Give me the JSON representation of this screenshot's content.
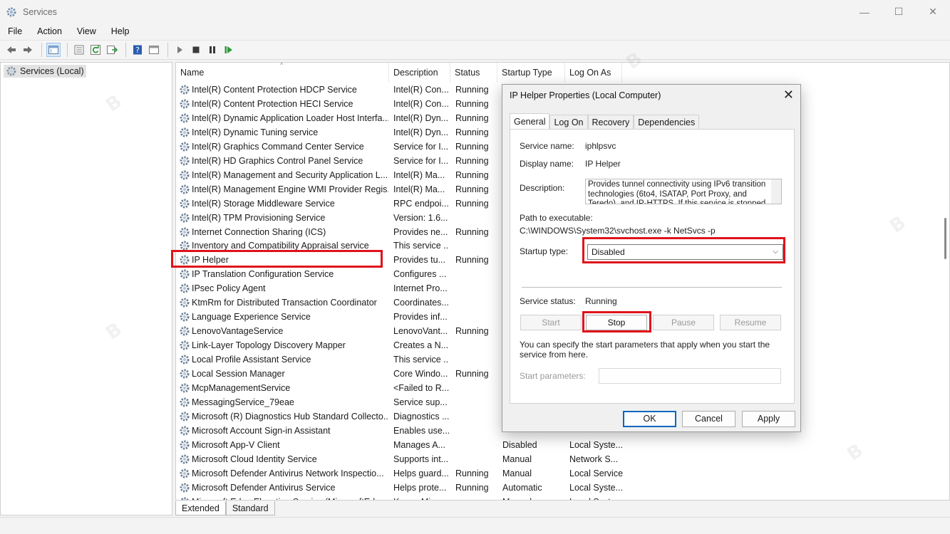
{
  "window": {
    "title": "Services",
    "controls": [
      "—",
      "☐",
      "✕"
    ]
  },
  "menu": [
    "File",
    "Action",
    "View",
    "Help"
  ],
  "toolbar": {
    "icons": [
      "back-icon",
      "forward-icon",
      "show-hide-console-tree-icon",
      "properties-icon",
      "refresh-icon",
      "export-list-icon",
      "help-icon",
      "console-icon",
      "start-service-icon",
      "stop-service-icon",
      "pause-service-icon",
      "restart-service-icon"
    ]
  },
  "tree": {
    "label": "Services (Local)"
  },
  "columns": {
    "name": "Name",
    "description": "Description",
    "status": "Status",
    "startup": "Startup Type",
    "logon": "Log On As"
  },
  "rows": [
    {
      "name": "Intel(R) Content Protection HDCP Service",
      "desc": "Intel(R) Con...",
      "status": "Running",
      "startup": "",
      "logon": ""
    },
    {
      "name": "Intel(R) Content Protection HECI Service",
      "desc": "Intel(R) Con...",
      "status": "Running",
      "startup": "",
      "logon": ""
    },
    {
      "name": "Intel(R) Dynamic Application Loader Host Interfa...",
      "desc": "Intel(R) Dyn...",
      "status": "Running",
      "startup": "",
      "logon": ""
    },
    {
      "name": "Intel(R) Dynamic Tuning service",
      "desc": "Intel(R) Dyn...",
      "status": "Running",
      "startup": "",
      "logon": ""
    },
    {
      "name": "Intel(R) Graphics Command Center Service",
      "desc": "Service for I...",
      "status": "Running",
      "startup": "",
      "logon": ""
    },
    {
      "name": "Intel(R) HD Graphics Control Panel Service",
      "desc": "Service for I...",
      "status": "Running",
      "startup": "",
      "logon": ""
    },
    {
      "name": "Intel(R) Management and Security Application L...",
      "desc": "Intel(R) Ma...",
      "status": "Running",
      "startup": "",
      "logon": ""
    },
    {
      "name": "Intel(R) Management Engine WMI Provider Regis...",
      "desc": "Intel(R) Ma...",
      "status": "Running",
      "startup": "",
      "logon": ""
    },
    {
      "name": "Intel(R) Storage Middleware Service",
      "desc": "RPC endpoi...",
      "status": "Running",
      "startup": "",
      "logon": ""
    },
    {
      "name": "Intel(R) TPM Provisioning Service",
      "desc": "Version: 1.6...",
      "status": "",
      "startup": "",
      "logon": ""
    },
    {
      "name": "Internet Connection Sharing (ICS)",
      "desc": "Provides ne...",
      "status": "Running",
      "startup": "",
      "logon": ""
    },
    {
      "name": "Inventory and Compatibility Appraisal service",
      "desc": "This service ...",
      "status": "",
      "startup": "",
      "logon": ""
    },
    {
      "name": "IP Helper",
      "desc": "Provides tu...",
      "status": "Running",
      "startup": "",
      "logon": ""
    },
    {
      "name": "IP Translation Configuration Service",
      "desc": "Configures ...",
      "status": "",
      "startup": "",
      "logon": ""
    },
    {
      "name": "IPsec Policy Agent",
      "desc": "Internet Pro...",
      "status": "",
      "startup": "",
      "logon": ""
    },
    {
      "name": "KtmRm for Distributed Transaction Coordinator",
      "desc": "Coordinates...",
      "status": "",
      "startup": "",
      "logon": ""
    },
    {
      "name": "Language Experience Service",
      "desc": "Provides inf...",
      "status": "",
      "startup": "",
      "logon": ""
    },
    {
      "name": "LenovoVantageService",
      "desc": "LenovoVant...",
      "status": "Running",
      "startup": "",
      "logon": ""
    },
    {
      "name": "Link-Layer Topology Discovery Mapper",
      "desc": "Creates a N...",
      "status": "",
      "startup": "",
      "logon": ""
    },
    {
      "name": "Local Profile Assistant Service",
      "desc": "This service ...",
      "status": "",
      "startup": "",
      "logon": ""
    },
    {
      "name": "Local Session Manager",
      "desc": "Core Windo...",
      "status": "Running",
      "startup": "",
      "logon": ""
    },
    {
      "name": "McpManagementService",
      "desc": "<Failed to R...",
      "status": "",
      "startup": "",
      "logon": ""
    },
    {
      "name": "MessagingService_79eae",
      "desc": "Service sup...",
      "status": "",
      "startup": "",
      "logon": ""
    },
    {
      "name": "Microsoft (R) Diagnostics Hub Standard Collecto...",
      "desc": "Diagnostics ...",
      "status": "",
      "startup": "",
      "logon": ""
    },
    {
      "name": "Microsoft Account Sign-in Assistant",
      "desc": "Enables use...",
      "status": "",
      "startup": "",
      "logon": ""
    },
    {
      "name": "Microsoft App-V Client",
      "desc": "Manages A...",
      "status": "",
      "startup": "Disabled",
      "logon": "Local Syste..."
    },
    {
      "name": "Microsoft Cloud Identity Service",
      "desc": "Supports int...",
      "status": "",
      "startup": "Manual",
      "logon": "Network S..."
    },
    {
      "name": "Microsoft Defender Antivirus Network Inspectio...",
      "desc": "Helps guard...",
      "status": "Running",
      "startup": "Manual",
      "logon": "Local Service"
    },
    {
      "name": "Microsoft Defender Antivirus Service",
      "desc": "Helps prote...",
      "status": "Running",
      "startup": "Automatic",
      "logon": "Local Syste..."
    },
    {
      "name": "Microsoft Edge Elevation Service (MicrosoftEdge...",
      "desc": "Keeps Micr...",
      "status": "",
      "startup": "Manual",
      "logon": "Local Syste..."
    }
  ],
  "bottom_tabs": [
    "Extended",
    "Standard"
  ],
  "dialog": {
    "title": "IP Helper Properties (Local Computer)",
    "tabs": [
      "General",
      "Log On",
      "Recovery",
      "Dependencies"
    ],
    "service_name_label": "Service name:",
    "service_name": "iphlpsvc",
    "display_name_label": "Display name:",
    "display_name": "IP Helper",
    "description_label": "Description:",
    "description": "Provides tunnel connectivity using IPv6 transition technologies (6to4, ISATAP, Port Proxy, and Teredo), and IP-HTTPS. If this service is stopped,",
    "path_label": "Path to executable:",
    "path": "C:\\WINDOWS\\System32\\svchost.exe -k NetSvcs -p",
    "startup_type_label": "Startup type:",
    "startup_type": "Disabled",
    "service_status_label": "Service status:",
    "service_status": "Running",
    "btn_start": "Start",
    "btn_stop": "Stop",
    "btn_pause": "Pause",
    "btn_resume": "Resume",
    "hint": "You can specify the start parameters that apply when you start the service from here.",
    "start_params_label": "Start parameters:",
    "start_params": "",
    "ok": "OK",
    "cancel": "Cancel",
    "apply": "Apply"
  },
  "highlight_color": "#e0121b"
}
